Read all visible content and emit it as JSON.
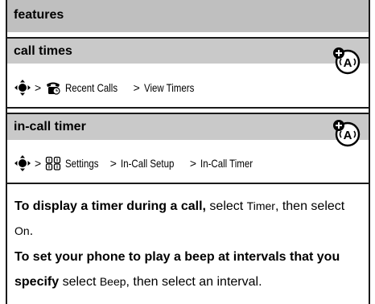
{
  "header": {
    "title": "features"
  },
  "sections": [
    {
      "title": "call times",
      "path": {
        "sep": ">",
        "items": [
          "Recent Calls",
          "View Timers"
        ],
        "item_icon": "recent-calls-icon"
      },
      "badge_icon": "network-feature-icon"
    },
    {
      "title": "in-call timer",
      "path": {
        "sep": ">",
        "items": [
          "Settings",
          "In-Call Setup",
          "In-Call Timer"
        ],
        "item_icon": "settings-icon"
      },
      "badge_icon": "network-feature-icon"
    }
  ],
  "para1": {
    "bold": "To display a timer during a call,",
    "t1": " select ",
    "c1": "Timer",
    "t2": ", then select ",
    "c2": "On",
    "t3": "."
  },
  "para2": {
    "bold": "To set your phone to play a beep at intervals that you specify",
    "t1": " select ",
    "c1": "Beep",
    "t2": ", then select an interval."
  },
  "colors": {
    "header_bg": "#bfbfbf",
    "section_bg": "#c9c9c9",
    "rule": "#1a1a1a"
  }
}
